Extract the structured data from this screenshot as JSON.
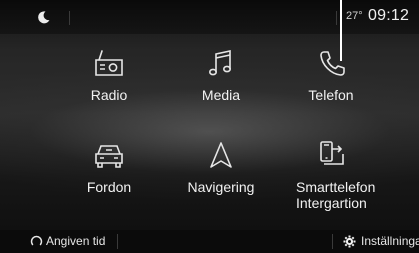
{
  "status_bar": {
    "mode_icon": "moon-icon",
    "temperature": "27°",
    "time": "09:12"
  },
  "apps": [
    {
      "label": "Radio",
      "icon": "radio-icon"
    },
    {
      "label": "Media",
      "icon": "music-note-icon"
    },
    {
      "label": "Telefon",
      "icon": "phone-icon"
    },
    {
      "label": "Fordon",
      "icon": "car-icon"
    },
    {
      "label": "Navigering",
      "icon": "navigation-arrow-icon"
    },
    {
      "label_line1": "Smarttelefon",
      "label_line2": "Intergartion",
      "icon": "smartphone-replication-icon"
    }
  ],
  "bottom_bar": {
    "left_label": "Angiven tid",
    "left_icon": "timer-icon",
    "right_label": "Inställningar",
    "right_icon": "gear-icon"
  },
  "colors": {
    "background": "#1a1a1a",
    "text": "#f2f2f2",
    "pointer_line": "#ffffff"
  }
}
